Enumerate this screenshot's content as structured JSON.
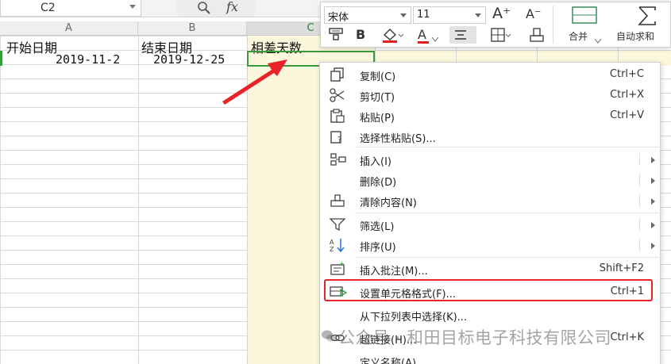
{
  "formula_bar": {
    "name_box": "C2",
    "fx_label": "fx"
  },
  "columns": [
    "A",
    "B",
    "C"
  ],
  "cells": {
    "a1": "开始日期",
    "b1": "结束日期",
    "c1": "相差天数",
    "a2": "2019-11-2",
    "b2": "2019-12-25"
  },
  "mini_toolbar": {
    "font_name": "宋体",
    "font_size": "11",
    "grow_font": "A⁺",
    "shrink_font": "A⁻",
    "bold": "B",
    "font_color_letter": "A",
    "merge_label": "合并",
    "autosum_label": "自动求和"
  },
  "context_menu": {
    "items": [
      {
        "label": "复制(C)",
        "shortcut": "Ctrl+C"
      },
      {
        "label": "剪切(T)",
        "shortcut": "Ctrl+X"
      },
      {
        "label": "粘贴(P)",
        "shortcut": "Ctrl+V"
      },
      {
        "label": "选择性粘贴(S)...",
        "shortcut": ""
      },
      {
        "label": "插入(I)",
        "shortcut": ""
      },
      {
        "label": "删除(D)",
        "shortcut": ""
      },
      {
        "label": "清除内容(N)",
        "shortcut": ""
      },
      {
        "label": "筛选(L)",
        "shortcut": ""
      },
      {
        "label": "排序(U)",
        "shortcut": ""
      },
      {
        "label": "插入批注(M)...",
        "shortcut": "Shift+F2"
      },
      {
        "label": "设置单元格格式(F)...",
        "shortcut": "Ctrl+1"
      },
      {
        "label": "从下拉列表中选择(K)...",
        "shortcut": ""
      },
      {
        "label": "超链接(H)...",
        "shortcut": "Ctrl+K"
      },
      {
        "label": "定义名称(A)...",
        "shortcut": ""
      }
    ]
  },
  "watermark": "公众号 · 和田目标电子科技有限公司",
  "colors": {
    "selection_green": "#3a9a3a",
    "highlight_red": "#e8232a",
    "font_color_red": "#e02020",
    "column_fill": "#fbf7dd"
  }
}
